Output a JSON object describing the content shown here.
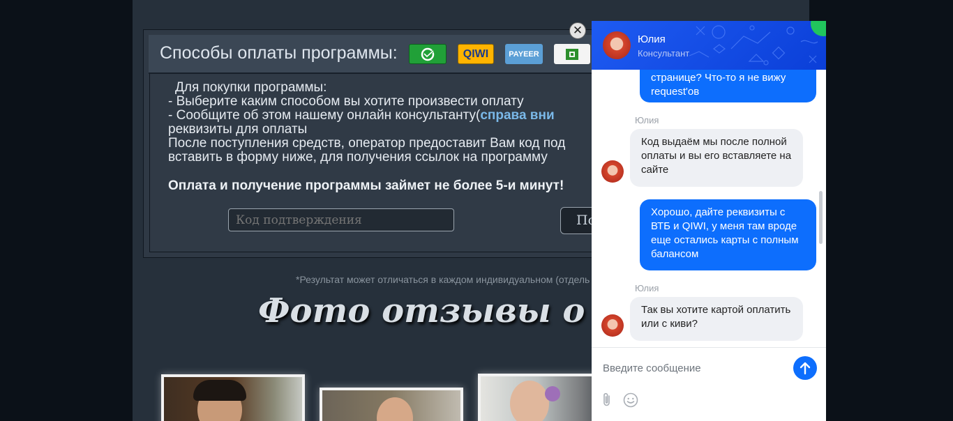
{
  "payment": {
    "title": "Способы оплаты программы:",
    "logos": {
      "sber": "sberbank-logo",
      "qiwi": "QIWI",
      "payeer": "PAYEER",
      "privat": "privatbank-logo"
    },
    "line1": "Для покупки программы:",
    "line2": "- Выберите каким способом вы хотите произвести оплату",
    "line3_prefix": "- Сообщите об этом нашему онлайн консультанту(",
    "line3_link": "справа вни",
    "line4": "реквизиты для оплаты",
    "line5": "После поступления средств, оператор предоставит Вам код под",
    "line6": "вставить в форму ниже, для получения ссылок на программу",
    "note": "Оплата и получение программы займет не более 5-и минут!",
    "code_placeholder": "Код подтверждения",
    "confirm_label": "По"
  },
  "disclaimer": "*Результат может отличаться в каждом индивидуальном (отдель",
  "reviews_title": "Фото отзывы о прогр",
  "chat": {
    "close_symbol": "✕",
    "agent_name": "Юлия",
    "agent_role": "Консультант",
    "messages": [
      {
        "from": "user",
        "text": "странице? Что-то я не вижу request'ов"
      },
      {
        "from": "agent",
        "sender": "Юлия",
        "text": "Код выдаём мы после полной оплаты и вы его вставляете на сайте"
      },
      {
        "from": "user",
        "text": "Хорошо, дайте реквизиты с ВТБ и QIWI, у меня там вроде еще остались карты с полным балансом"
      },
      {
        "from": "agent",
        "sender": "Юлия",
        "text": "Так вы хотите картой оплатить или с киви?"
      }
    ],
    "input_placeholder": "Введите сообщение",
    "accent_color": "#0d6efd"
  }
}
